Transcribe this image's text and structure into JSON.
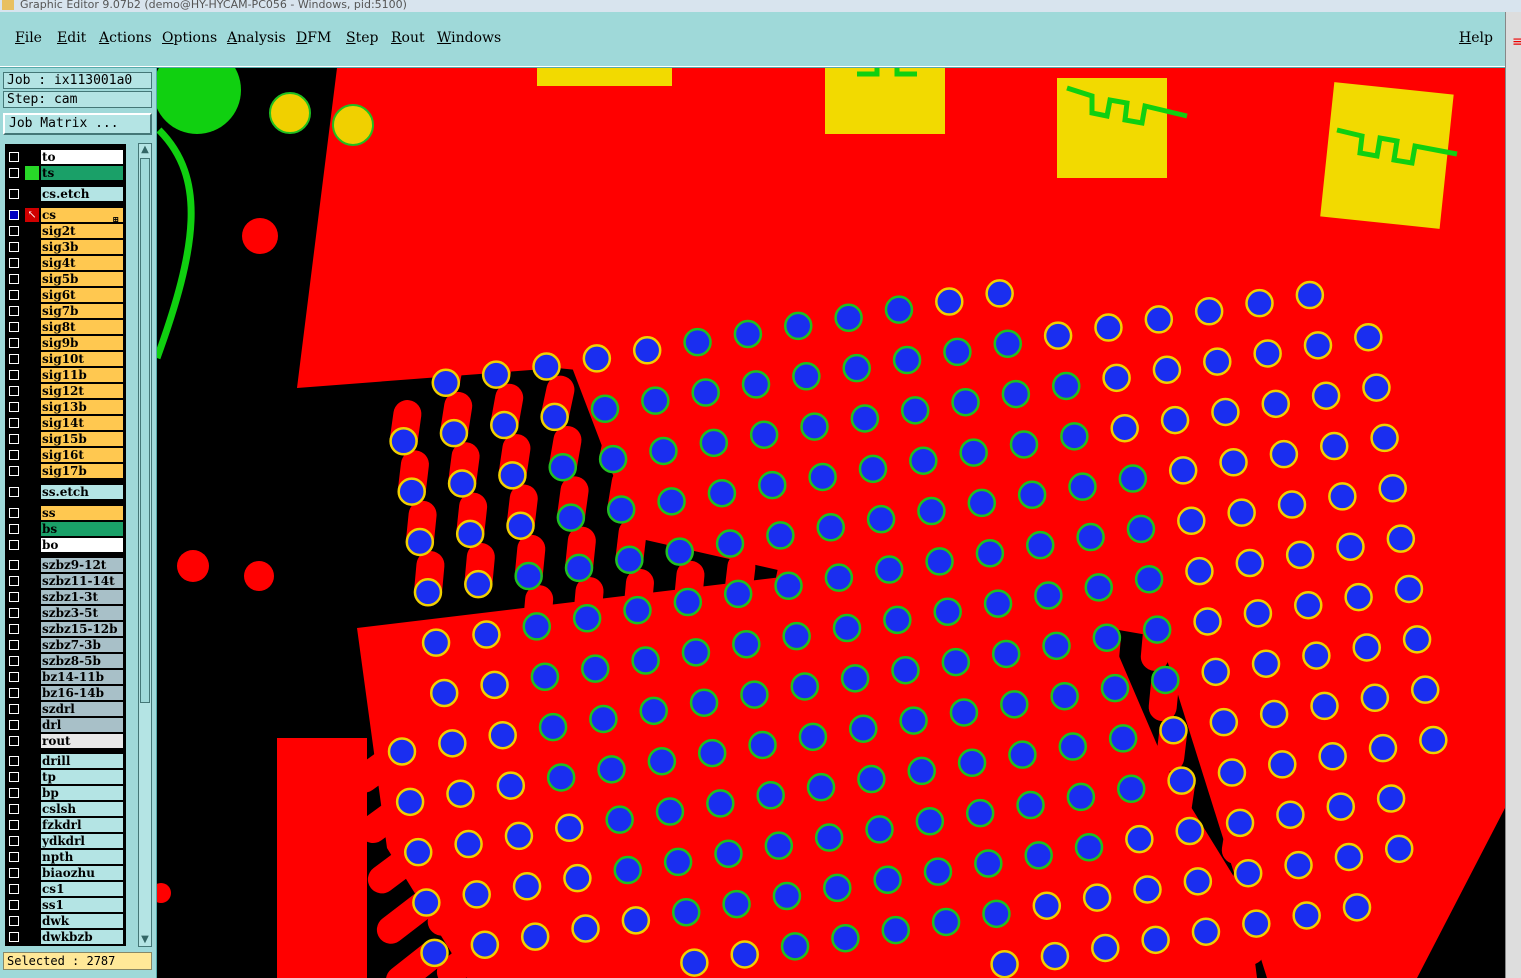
{
  "window": {
    "title": "Graphic Editor 9.07b2 (demo@HY-HYCAM-PC056 - Windows, pid:5100)"
  },
  "menubar": {
    "items": [
      "File",
      "Edit",
      "Actions",
      "Options",
      "Analysis",
      "DFM",
      "Step",
      "Rout",
      "Windows"
    ],
    "help": "Help"
  },
  "sidebar": {
    "job": "Job : ix113001a0",
    "step": "Step: cam",
    "job_matrix_button": "Job Matrix ...",
    "selected": "Selected : 2787",
    "layers": [
      {
        "name": "to",
        "color": "#ffffff",
        "marker": "",
        "checked": false
      },
      {
        "name": "ts",
        "color": "#1aa068",
        "marker": "#28d828",
        "checked": false
      },
      {
        "name": "cs.etch",
        "color": "#b4e4e4",
        "marker": "",
        "checked": false
      },
      {
        "name": "cs",
        "color": "#ffc850",
        "marker": "#ffffff",
        "checked": true
      },
      {
        "name": "sig2t",
        "color": "#ffc850",
        "marker": "",
        "checked": false
      },
      {
        "name": "sig3b",
        "color": "#ffc850",
        "marker": "",
        "checked": false
      },
      {
        "name": "sig4t",
        "color": "#ffc850",
        "marker": "",
        "checked": false
      },
      {
        "name": "sig5b",
        "color": "#ffc850",
        "marker": "",
        "checked": false
      },
      {
        "name": "sig6t",
        "color": "#ffc850",
        "marker": "",
        "checked": false
      },
      {
        "name": "sig7b",
        "color": "#ffc850",
        "marker": "",
        "checked": false
      },
      {
        "name": "sig8t",
        "color": "#ffc850",
        "marker": "",
        "checked": false
      },
      {
        "name": "sig9b",
        "color": "#ffc850",
        "marker": "",
        "checked": false
      },
      {
        "name": "sig10t",
        "color": "#ffc850",
        "marker": "",
        "checked": false
      },
      {
        "name": "sig11b",
        "color": "#ffc850",
        "marker": "",
        "checked": false
      },
      {
        "name": "sig12t",
        "color": "#ffc850",
        "marker": "",
        "checked": false
      },
      {
        "name": "sig13b",
        "color": "#ffc850",
        "marker": "",
        "checked": false
      },
      {
        "name": "sig14t",
        "color": "#ffc850",
        "marker": "",
        "checked": false
      },
      {
        "name": "sig15b",
        "color": "#ffc850",
        "marker": "",
        "checked": false
      },
      {
        "name": "sig16t",
        "color": "#ffc850",
        "marker": "",
        "checked": false
      },
      {
        "name": "sig17b",
        "color": "#ffc850",
        "marker": "",
        "checked": false
      },
      {
        "name": "ss.etch",
        "color": "#b4e4e4",
        "marker": "",
        "checked": false
      },
      {
        "name": "ss",
        "color": "#ffc850",
        "marker": "",
        "checked": false
      },
      {
        "name": "bs",
        "color": "#1aa068",
        "marker": "",
        "checked": false
      },
      {
        "name": "bo",
        "color": "#ffffff",
        "marker": "",
        "checked": false
      },
      {
        "name": "szbz9-12t",
        "color": "#a8c0c8",
        "marker": "",
        "checked": false
      },
      {
        "name": "szbz11-14t",
        "color": "#a8c0c8",
        "marker": "",
        "checked": false
      },
      {
        "name": "szbz1-3t",
        "color": "#a8c0c8",
        "marker": "",
        "checked": false
      },
      {
        "name": "szbz3-5t",
        "color": "#a8c0c8",
        "marker": "",
        "checked": false
      },
      {
        "name": "szbz15-12b",
        "color": "#a8c0c8",
        "marker": "",
        "checked": false
      },
      {
        "name": "szbz7-3b",
        "color": "#a8c0c8",
        "marker": "",
        "checked": false
      },
      {
        "name": "szbz8-5b",
        "color": "#a8c0c8",
        "marker": "",
        "checked": false
      },
      {
        "name": "bz14-11b",
        "color": "#a8c0c8",
        "marker": "",
        "checked": false
      },
      {
        "name": "bz16-14b",
        "color": "#a8c0c8",
        "marker": "",
        "checked": false
      },
      {
        "name": "szdrl",
        "color": "#a8c0c8",
        "marker": "",
        "checked": false
      },
      {
        "name": "drl",
        "color": "#a8c0c8",
        "marker": "",
        "checked": false
      },
      {
        "name": "rout",
        "color": "#e8e8e8",
        "marker": "",
        "checked": false
      },
      {
        "name": "drill",
        "color": "#b4e4e4",
        "marker": "",
        "checked": false
      },
      {
        "name": "tp",
        "color": "#b4e4e4",
        "marker": "",
        "checked": false
      },
      {
        "name": "bp",
        "color": "#b4e4e4",
        "marker": "",
        "checked": false
      },
      {
        "name": "cslsh",
        "color": "#b4e4e4",
        "marker": "",
        "checked": false
      },
      {
        "name": "fzkdrl",
        "color": "#b4e4e4",
        "marker": "",
        "checked": false
      },
      {
        "name": "ydkdrl",
        "color": "#b4e4e4",
        "marker": "",
        "checked": false
      },
      {
        "name": "npth",
        "color": "#b4e4e4",
        "marker": "",
        "checked": false
      },
      {
        "name": "biaozhu",
        "color": "#b4e4e4",
        "marker": "",
        "checked": false
      },
      {
        "name": "cs1",
        "color": "#b4e4e4",
        "marker": "",
        "checked": false
      },
      {
        "name": "ss1",
        "color": "#b4e4e4",
        "marker": "",
        "checked": false
      },
      {
        "name": "dwk",
        "color": "#b4e4e4",
        "marker": "",
        "checked": false
      },
      {
        "name": "dwkbzb",
        "color": "#b4e4e4",
        "marker": "",
        "checked": false
      }
    ]
  },
  "colors": {
    "copper": "#ff0000",
    "pad_fill": "#1a2ef0",
    "pad_ring_yellow": "#f0d000",
    "pad_ring_green": "#20c020",
    "smd_yellow": "#f2da00",
    "trace_green": "#10d010",
    "background": "#000000"
  }
}
